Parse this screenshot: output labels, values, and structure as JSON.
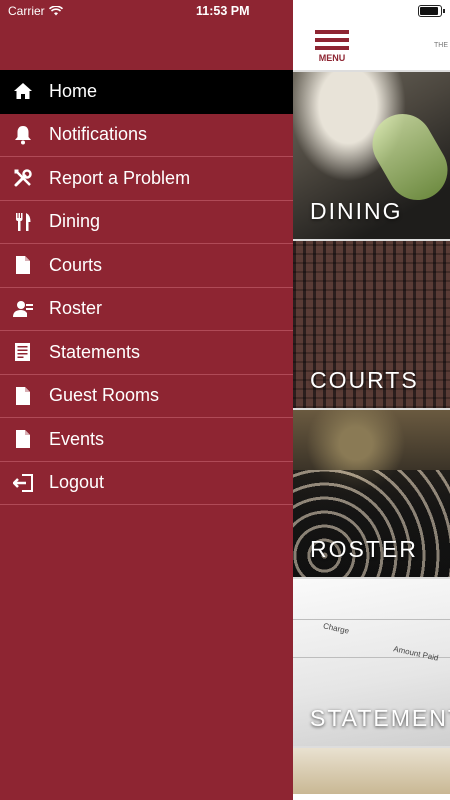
{
  "status": {
    "carrier": "Carrier",
    "time": "11:53 PM"
  },
  "header": {
    "menu_label": "MENU",
    "brand_fragment": "THE"
  },
  "menu": {
    "items": [
      {
        "label": "Home",
        "icon": "home-icon",
        "active": true
      },
      {
        "label": "Notifications",
        "icon": "bell-icon"
      },
      {
        "label": "Report a Problem",
        "icon": "tools-icon"
      },
      {
        "label": "Dining",
        "icon": "utensils-icon"
      },
      {
        "label": "Courts",
        "icon": "document-icon"
      },
      {
        "label": "Roster",
        "icon": "roster-icon"
      },
      {
        "label": "Statements",
        "icon": "statement-icon"
      },
      {
        "label": "Guest Rooms",
        "icon": "document-icon"
      },
      {
        "label": "Events",
        "icon": "document-icon"
      },
      {
        "label": "Logout",
        "icon": "logout-icon"
      }
    ]
  },
  "tiles": [
    {
      "label": "DINING"
    },
    {
      "label": "COURTS"
    },
    {
      "label": "ROSTER"
    },
    {
      "label": "STATEMENTS"
    }
  ],
  "statement_preview": {
    "charge": "Charge",
    "amount_paid": "Amount Paid"
  },
  "colors": {
    "brand": "#8e2532",
    "active_item": "#000000",
    "divider": "#b04a57"
  }
}
